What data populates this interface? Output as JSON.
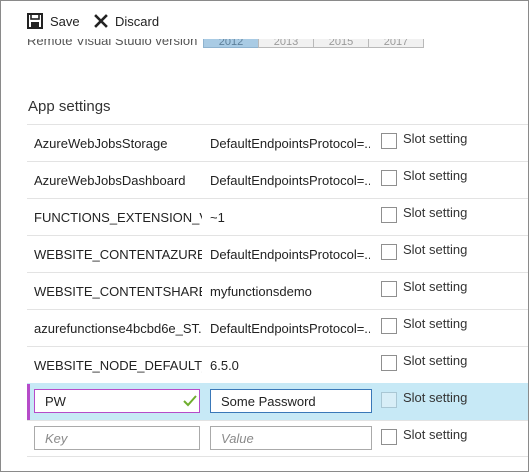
{
  "toolbar": {
    "save_label": "Save",
    "discard_label": "Discard"
  },
  "remote_vs": {
    "label": "Remote Visual Studio version",
    "options": [
      "2012",
      "2013",
      "2015",
      "2017"
    ],
    "selected": "2012"
  },
  "app_settings": {
    "title": "App settings",
    "slot_setting_label": "Slot setting",
    "rows": [
      {
        "name": "AzureWebJobsStorage",
        "value": "DefaultEndpointsProtocol=..."
      },
      {
        "name": "AzureWebJobsDashboard",
        "value": "DefaultEndpointsProtocol=..."
      },
      {
        "name": "FUNCTIONS_EXTENSION_VE...",
        "value": "~1"
      },
      {
        "name": "WEBSITE_CONTENTAZUREFI...",
        "value": "DefaultEndpointsProtocol=..."
      },
      {
        "name": "WEBSITE_CONTENTSHARE",
        "value": "myfunctionsdemo"
      },
      {
        "name": "azurefunctionse4bcbd6e_ST...",
        "value": "DefaultEndpointsProtocol=..."
      },
      {
        "name": "WEBSITE_NODE_DEFAULT_V...",
        "value": "6.5.0"
      }
    ],
    "editing_row": {
      "key_value": "PW",
      "value_value": "Some Password"
    },
    "new_row": {
      "key_placeholder": "Key",
      "value_placeholder": "Value"
    }
  },
  "colors": {
    "selected_segment": "#a9cbe4",
    "editing_row_bg": "#c7e9f6",
    "editing_accent": "#b64bc9",
    "valid_check": "#6fae2e"
  }
}
